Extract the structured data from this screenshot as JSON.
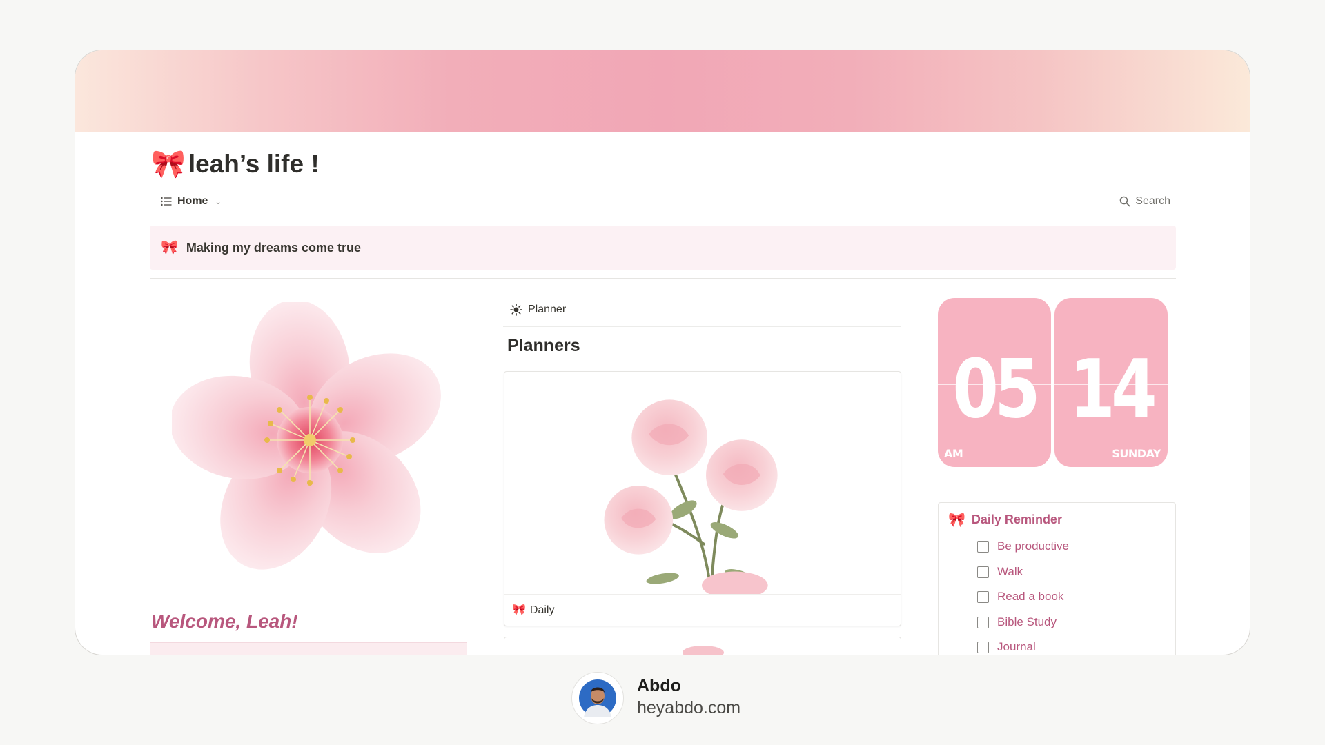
{
  "page": {
    "title": "leah’s life !",
    "title_icon": "bow-icon"
  },
  "viewbar": {
    "active_view": "Home",
    "search_label": "Search"
  },
  "callout": {
    "text": "Making my dreams come true"
  },
  "left_column": {
    "welcome": "Welcome, Leah!"
  },
  "planner": {
    "tab_label": "Planner",
    "heading": "Planners",
    "cards": [
      {
        "label": "Daily"
      }
    ]
  },
  "clock": {
    "hour": "05",
    "minute": "14",
    "period": "AM",
    "day": "SUNDAY"
  },
  "reminder": {
    "title": "Daily Reminder",
    "items": [
      {
        "label": "Be productive",
        "checked": false
      },
      {
        "label": "Walk",
        "checked": false
      },
      {
        "label": "Read a book",
        "checked": false
      },
      {
        "label": "Bible Study",
        "checked": false
      },
      {
        "label": "Journal",
        "checked": false
      }
    ]
  },
  "attribution": {
    "name": "Abdo",
    "site": "heyabdo.com"
  },
  "colors": {
    "accent_pink": "#b8577d",
    "clock_pink": "#f7b3c1",
    "callout_bg": "#fcf1f4"
  }
}
